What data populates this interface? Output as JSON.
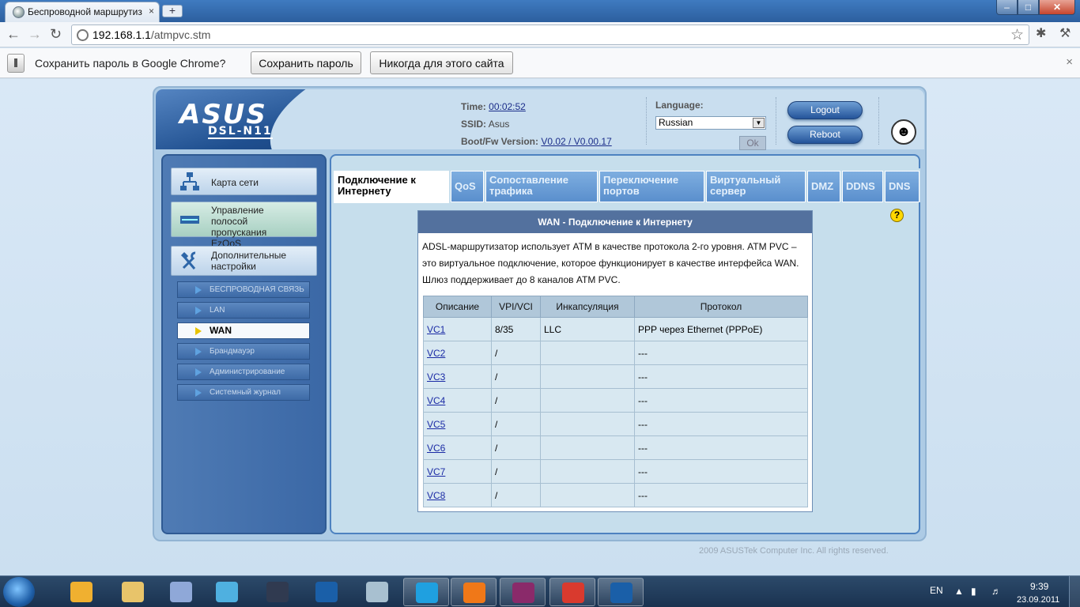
{
  "browser": {
    "tab_title": "Беспроводной маршрутиз",
    "tab_close": "×",
    "new_tab": "+",
    "url_host": "192.168.1.1",
    "url_path": "/atmpvc.stm",
    "window_buttons": {
      "minimize": "–",
      "maximize": "□",
      "close": "✕"
    }
  },
  "infobar": {
    "message": "Сохранить пароль в Google Chrome?",
    "save_label": "Сохранить пароль",
    "never_label": "Никогда для этого сайта",
    "close": "×"
  },
  "router": {
    "logo": "ASUS",
    "model": "DSL-N11",
    "time_label": "Time:",
    "time_value": "00:02:52",
    "ssid_label": "SSID:",
    "ssid_value": "Asus",
    "fw_label": "Boot/Fw Version:",
    "fw_value": "V0.02 / V0.00.17",
    "language_label": "Language:",
    "language_value": "Russian",
    "ok_label": "Ok",
    "logout_label": "Logout",
    "reboot_label": "Reboot"
  },
  "sidebar": {
    "main_items": [
      {
        "label": "Карта сети",
        "icon": "network-map-icon"
      },
      {
        "label": "Управление полосой пропускания EzQoS",
        "icon": "ezqos-icon"
      },
      {
        "label": "Дополнительные настройки",
        "icon": "tools-icon"
      }
    ],
    "sub_items": [
      {
        "label": "БЕСПРОВОДНАЯ СВЯЗЬ"
      },
      {
        "label": "LAN"
      },
      {
        "label": "WAN",
        "active": true
      },
      {
        "label": "Брандмауэр"
      },
      {
        "label": "Администрирование"
      },
      {
        "label": "Системный журнал"
      }
    ]
  },
  "tabs": [
    {
      "label": "Подключение к Интернету",
      "active": true
    },
    {
      "label": "QoS"
    },
    {
      "label": "Сопоставление трафика"
    },
    {
      "label": "Переключение портов"
    },
    {
      "label": "Виртуальный сервер"
    },
    {
      "label": "DMZ"
    },
    {
      "label": "DDNS"
    },
    {
      "label": "DNS"
    }
  ],
  "panel": {
    "title": "WAN - Подключение к Интернету",
    "description": "ADSL-маршрутизатор использует ATM в качестве протокола 2-го уровня. ATM PVC – это виртуальное подключение, которое функционирует в качестве интерфейса WAN. Шлюз поддерживает до 8 каналов ATM PVC.",
    "columns": [
      "Описание",
      "VPI/VCI",
      "Инкапсуляция",
      "Протокол"
    ],
    "rows": [
      [
        "VC1",
        "8/35",
        "LLC",
        "PPP через Ethernet (PPPoE)"
      ],
      [
        "VC2",
        "/",
        "",
        "---"
      ],
      [
        "VC3",
        "/",
        "",
        "---"
      ],
      [
        "VC4",
        "/",
        "",
        "---"
      ],
      [
        "VC5",
        "/",
        "",
        "---"
      ],
      [
        "VC6",
        "/",
        "",
        "---"
      ],
      [
        "VC7",
        "/",
        "",
        "---"
      ],
      [
        "VC8",
        "/",
        "",
        "---"
      ]
    ]
  },
  "footer": "2009 ASUSTek Computer Inc. All rights reserved.",
  "taskbar": {
    "apps": [
      {
        "name": "media-player-icon",
        "color": "#f0b030"
      },
      {
        "name": "explorer-icon",
        "color": "#e8c46a"
      },
      {
        "name": "paint-icon",
        "color": "#8fa8d8"
      },
      {
        "name": "music-icon",
        "color": "#4fb0e0"
      },
      {
        "name": "kmplayer-icon",
        "color": "#303a50"
      },
      {
        "name": "photoshop-icon",
        "color": "#1a5fa8"
      },
      {
        "name": "device-icon",
        "color": "#a8c0d0"
      },
      {
        "name": "skype-icon",
        "color": "#1fa0e0",
        "open": true
      },
      {
        "name": "mail-icon",
        "color": "#f07818",
        "open": true
      },
      {
        "name": "winrar-icon",
        "color": "#8a2a6a",
        "open": true
      },
      {
        "name": "chrome-icon",
        "color": "#d93a2e",
        "open": true
      },
      {
        "name": "photoshop-icon",
        "color": "#1a5fa8",
        "open": true
      }
    ],
    "lang": "EN",
    "time": "9:39",
    "date": "23.09.2011"
  }
}
